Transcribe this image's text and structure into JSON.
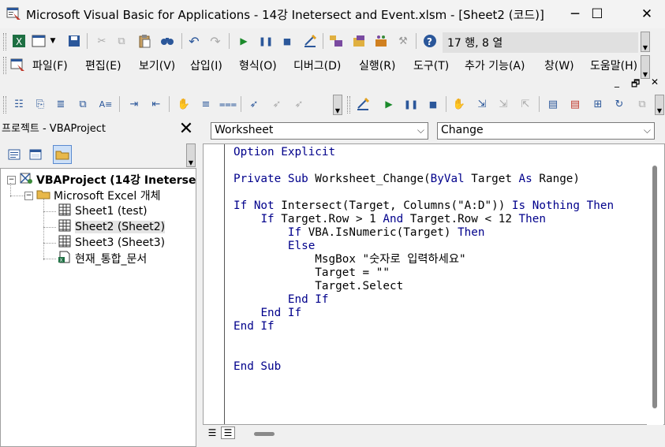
{
  "window": {
    "title": "Microsoft Visual Basic for Applications - 14강 Inetersect and Event.xlsm - [Sheet2 (코드)]",
    "minimize": "─",
    "maximize": "☐",
    "close": "✕"
  },
  "toolbar": {
    "position": "17 행, 8 열"
  },
  "menu": {
    "items": [
      "파일(F)",
      "편집(E)",
      "보기(V)",
      "삽입(I)",
      "형식(O)",
      "디버그(D)",
      "실행(R)",
      "도구(T)",
      "추가 기능(A)",
      "창(W)",
      "도움말(H)"
    ],
    "mdi_min": "_",
    "mdi_restore": "🗗",
    "mdi_close": "✕"
  },
  "project": {
    "title": "프로젝트 - VBAProject",
    "close": "✕",
    "tree": {
      "root": "VBAProject (14강 Inetersect",
      "folder": "Microsoft Excel 개체",
      "items": [
        "Sheet1 (test)",
        "Sheet2 (Sheet2)",
        "Sheet3 (Sheet3)",
        "현재_통합_문서"
      ]
    }
  },
  "code": {
    "object_combo": "Worksheet",
    "procedure_combo": "Change",
    "lines": [
      "Option Explicit",
      "",
      "Private Sub Worksheet_Change(ByVal Target As Range)",
      "",
      "If Not Intersect(Target, Columns(\"A:D\")) Is Nothing Then",
      "    If Target.Row > 1 And Target.Row < 12 Then",
      "        If VBA.IsNumeric(Target) Then",
      "        Else",
      "            MsgBox \"숫자로 입력하세요\"",
      "            Target = \"\"",
      "            Target.Select",
      "        End If",
      "    End If",
      "End If",
      "",
      "",
      "End Sub"
    ]
  },
  "colors": {
    "keyword": "#00008b",
    "background": "#f0f0f0",
    "editor": "#ffffff"
  }
}
